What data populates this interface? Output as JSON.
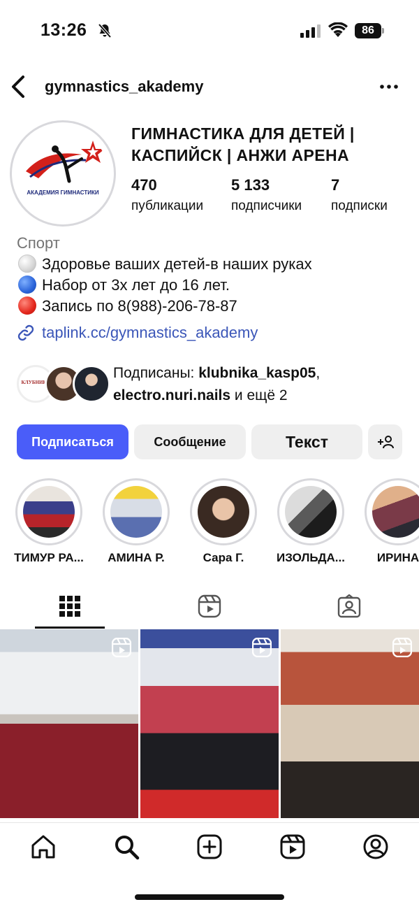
{
  "status_bar": {
    "time": "13:26",
    "battery": "86"
  },
  "header": {
    "username": "gymnastics_akademy"
  },
  "profile": {
    "avatar_text": "АКАДЕМИЯ ГИМНАСТИКИ",
    "title_line1": "ГИМНАСТИКА ДЛЯ ДЕТЕЙ |",
    "title_line2": "КАСПИЙСК | АНЖИ АРЕНА",
    "stats": [
      {
        "value": "470",
        "label": "публикации"
      },
      {
        "value": "5 133",
        "label": "подписчики"
      },
      {
        "value": "7",
        "label": "подписки"
      }
    ]
  },
  "bio": {
    "category": "Спорт",
    "lines": [
      "Здоровье ваших детей-в наших руках",
      "Набор от 3х лет до 16 лет.",
      "Запись по 8(988)-206-78-87"
    ],
    "link": "taplink.cc/gymnastics_akademy"
  },
  "followed_by": {
    "prefix": "Подписаны: ",
    "user1": "klubnika_kasp05",
    "sep": ",",
    "user2": "electro.nuri.nails",
    "suffix": " и ещё 2",
    "avatar1_text": "КЛУБНИКА"
  },
  "actions": {
    "follow": "Подписаться",
    "message": "Сообщение",
    "text": "Текст"
  },
  "highlights": [
    {
      "label": "ТИМУР РА..."
    },
    {
      "label": "АМИНА Р."
    },
    {
      "label": "Сара Г."
    },
    {
      "label": "ИЗОЛЬДА..."
    },
    {
      "label": "ИРИНА"
    }
  ],
  "colors": {
    "accent": "#4a5df9",
    "link": "#3b56b8",
    "secondary_text": "#737373",
    "button_gray": "#efefef"
  }
}
